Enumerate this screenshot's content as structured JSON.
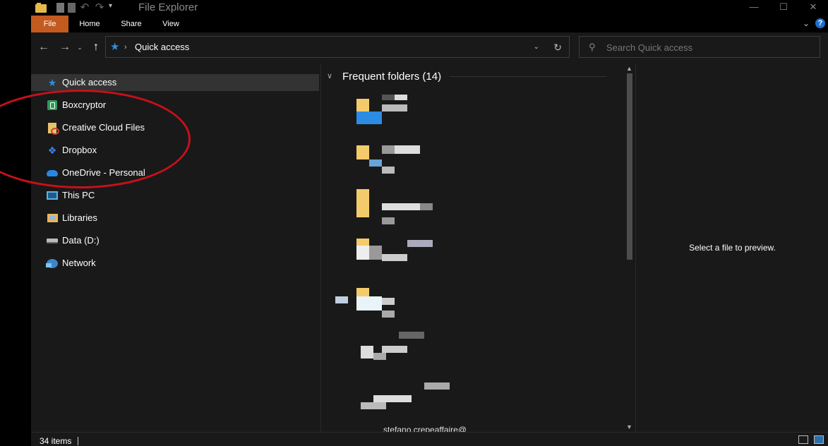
{
  "window": {
    "title": "File Explorer"
  },
  "caption_buttons": {
    "minimize": "—",
    "maximize": "☐",
    "close": "✕"
  },
  "ribbon": {
    "tabs": [
      "File",
      "Home",
      "Share",
      "View"
    ],
    "help": "?"
  },
  "address_bar": {
    "path": "Quick access"
  },
  "search": {
    "placeholder": "Search Quick access"
  },
  "navigation_pane": {
    "items": [
      {
        "label": "Quick access",
        "icon": "quick-access-star-icon",
        "selected": true
      },
      {
        "label": "Boxcryptor",
        "icon": "boxcryptor-icon",
        "selected": false
      },
      {
        "label": "Creative Cloud Files",
        "icon": "creative-cloud-icon",
        "selected": false
      },
      {
        "label": "Dropbox",
        "icon": "dropbox-icon",
        "selected": false
      },
      {
        "label": "OneDrive - Personal",
        "icon": "onedrive-icon",
        "selected": false
      },
      {
        "label": "This PC",
        "icon": "this-pc-icon",
        "selected": false
      },
      {
        "label": "Libraries",
        "icon": "libraries-icon",
        "selected": false
      },
      {
        "label": "Data (D:)",
        "icon": "drive-icon",
        "selected": false
      },
      {
        "label": "Network",
        "icon": "network-icon",
        "selected": false
      }
    ]
  },
  "content": {
    "group_title": "Frequent folders (14)",
    "partial_label": "stefano.crepeaffaire@"
  },
  "preview": {
    "message": "Select a file to preview."
  },
  "status_bar": {
    "item_count": "34 items"
  },
  "colors": {
    "file_tab": "#c35a1f",
    "background": "#191919",
    "selected": "#333333",
    "annotation": "#c8101a"
  }
}
